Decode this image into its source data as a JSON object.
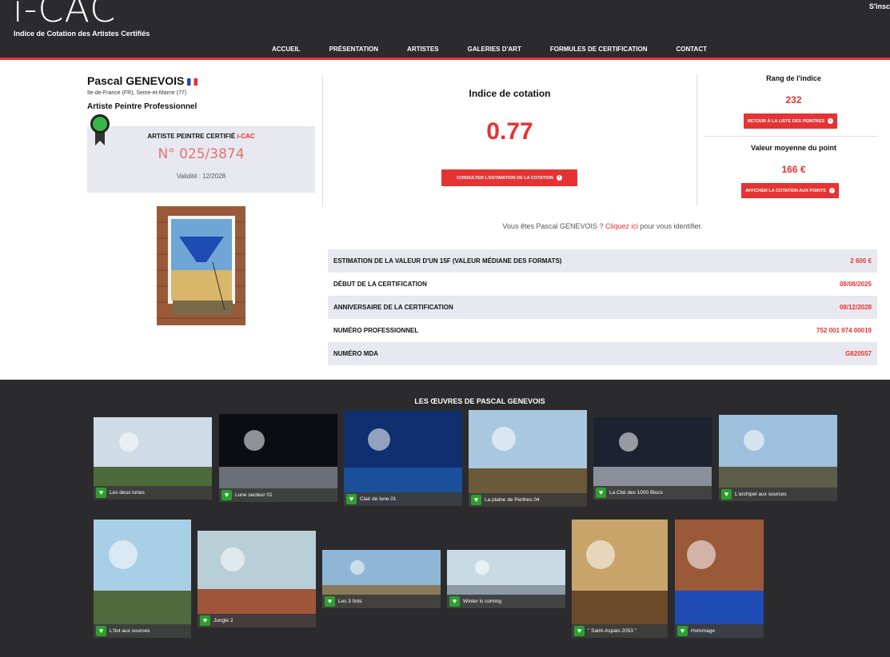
{
  "header": {
    "logo_text": "i-CAC",
    "tagline": "Indice de Cotation des Artistes Certifiés",
    "signin": "S'insc",
    "nav": [
      "ACCUEIL",
      "PRÉSENTATION",
      "ARTISTES",
      "GALERIES D'ART",
      "FORMULES DE CERTIFICATION",
      "CONTACT"
    ]
  },
  "artist": {
    "name": "Pascal GENEVOIS",
    "location": "Ile-de-France (FR), Seine-et-Marne (77)",
    "role": "Artiste Peintre Professionnel"
  },
  "certificate": {
    "title_prefix": "ARTISTE PEINTRE CERTIFIÉ ",
    "title_brand": "i-CAC",
    "number": "N° 025/3874",
    "validity": "Validité : 12/2028"
  },
  "index": {
    "title": "Indice de cotation",
    "value": "0.77",
    "button": "CONSULTER L'ESTIMATION DE LA COTATION"
  },
  "rank": {
    "title": "Rang de l'indice",
    "value": "232",
    "button": "RETOUR À LA LISTE DES PEINTRES"
  },
  "point": {
    "title": "Valeur moyenne du point",
    "value": "166 €",
    "button": "AFFICHER LA COTATION AUX POINTS"
  },
  "identify": {
    "prefix": "Vous êtes Pascal GENEVOIS ? ",
    "link": "Cliquez ici",
    "suffix": " pour vous identifier."
  },
  "info_rows": [
    {
      "label": "ESTIMATION DE LA VALEUR D'UN 15F (VALEUR MÉDIANE DES FORMATS)",
      "value": "2 600 €"
    },
    {
      "label": "DÉBUT DE LA CERTIFICATION",
      "value": "08/08/2025"
    },
    {
      "label": "ANNIVERSAIRE DE LA CERTIFICATION",
      "value": "08/12/2028"
    },
    {
      "label": "NUMÉRO PROFESSIONNEL",
      "value": "752 001 974 00019"
    },
    {
      "label": "NUMÉRO MDA",
      "value": "G820557"
    }
  ],
  "gallery": {
    "title": "LES ŒUVRES DE PASCAL GENEVOIS",
    "works": [
      {
        "title": "Les deux lunes",
        "colors": [
          "#cfdbe6",
          "#4d6a3a"
        ]
      },
      {
        "title": "Lune secteur 01",
        "colors": [
          "#0b0d12",
          "#6b6f78"
        ]
      },
      {
        "title": "Clair de lune 01",
        "colors": [
          "#0f2f6e",
          "#1a4f9a"
        ]
      },
      {
        "title": "La plaine de Perthes 04",
        "colors": [
          "#a9c7df",
          "#6a5a3a"
        ]
      },
      {
        "title": "La Cité des 1000 Blocs",
        "colors": [
          "#1c2230",
          "#8a8f99"
        ]
      },
      {
        "title": "L'archipel aux sources",
        "colors": [
          "#9ec0dd",
          "#5c5e4a"
        ]
      },
      {
        "title": "L'Ilot aux sources",
        "colors": [
          "#a9cfe6",
          "#4f6a3d"
        ]
      },
      {
        "title": "Jungle 2",
        "colors": [
          "#b8cfd8",
          "#a0553a"
        ]
      },
      {
        "title": "Les 3 îlots",
        "colors": [
          "#8fb6d6",
          "#8a7a5a"
        ]
      },
      {
        "title": "Winter is coming",
        "colors": [
          "#c8dbe4",
          "#8c9aa4"
        ]
      },
      {
        "title": "\" Saint-Aspais 2053 \"",
        "colors": [
          "#c9a46a",
          "#6b4a2a"
        ]
      },
      {
        "title": "Hommage",
        "colors": [
          "#9a5a3a",
          "#1f4bb4"
        ]
      }
    ]
  }
}
